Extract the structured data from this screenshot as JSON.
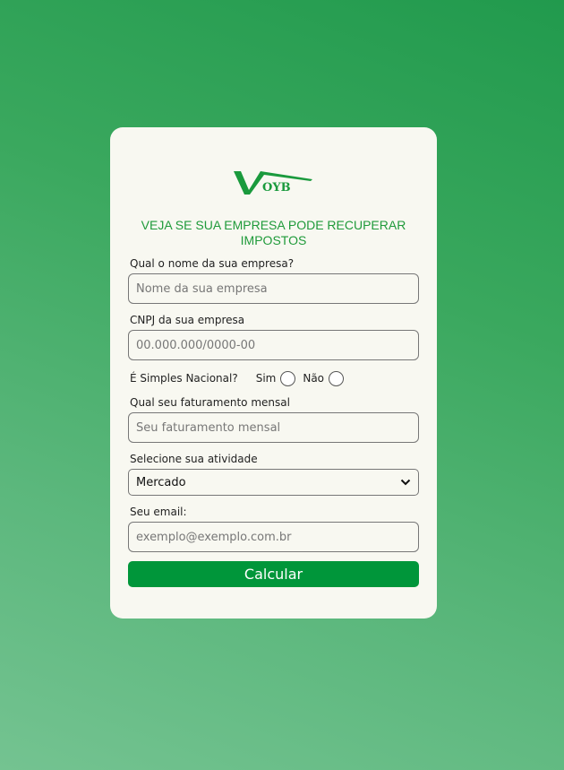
{
  "logo": {
    "text": "VOYB"
  },
  "title": "VEJA SE SUA EMPRESA PODE RECUPERAR IMPOSTOS",
  "fields": {
    "company_label": "Qual o nome da sua empresa?",
    "company_placeholder": "Nome da sua empresa",
    "cnpj_label": "CNPJ da sua empresa",
    "cnpj_placeholder": "00.000.000/0000-00",
    "simples_label": "É Simples Nacional?",
    "simples_yes": "Sim",
    "simples_no": "Não",
    "revenue_label": "Qual seu faturamento mensal",
    "revenue_placeholder": "Seu faturamento mensal",
    "activity_label": "Selecione sua atividade",
    "activity_selected": "Mercado",
    "email_label": "Seu email:",
    "email_placeholder": "exemplo@exemplo.com.br"
  },
  "submit_label": "Calcular",
  "colors": {
    "accent": "#00963a",
    "title": "#1f9a3a",
    "card": "#f8f8f1"
  },
  "icons": {
    "select_arrow": "chevron-down-icon"
  }
}
